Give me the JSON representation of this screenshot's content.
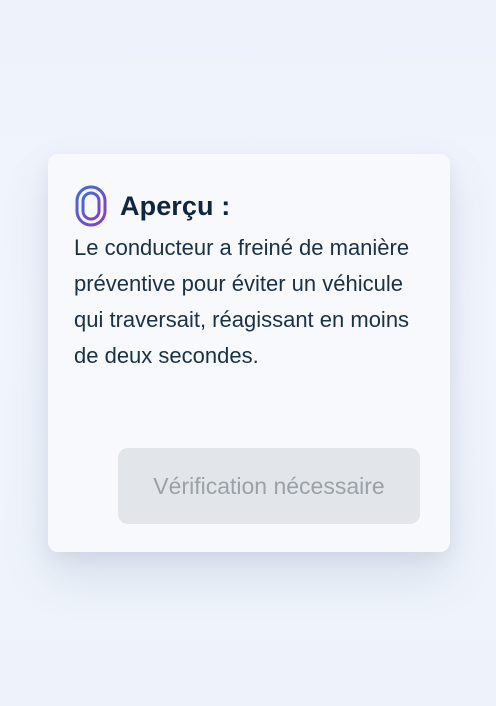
{
  "card": {
    "title": "Aperçu :",
    "icon": "fingerprint-icon",
    "body": "Le conducteur a freiné de manière préventive pour éviter un véhicule qui traversait, réagissant en moins de deux secondes.",
    "button_label": "Vérification nécessaire",
    "button_state": "disabled"
  },
  "colors": {
    "icon_gradient_start": "#3d6fd6",
    "icon_gradient_end": "#8b3cc9",
    "title": "#10263f",
    "body_text": "#1a3148",
    "button_bg": "#e2e6ea",
    "button_text": "#9aa2a8"
  }
}
